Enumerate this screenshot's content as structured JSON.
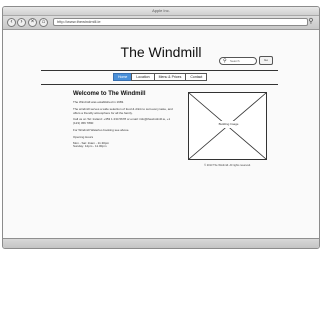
{
  "browser": {
    "title": "Apple Inc.",
    "url": "http://www.thewindmill.ie"
  },
  "header": {
    "logo": "The Windmill",
    "search_placeholder": "Search",
    "go_label": "Go"
  },
  "nav": {
    "items": [
      "Home",
      "Location",
      "Menu & Prices",
      "Contact"
    ],
    "active": "Home"
  },
  "main": {
    "heading": "Welcome to The Windmill",
    "paragraphs": [
      "The Windmill was established in 1983.",
      "The windmill serves a wide selection of food & drink to suit every taste, and offers a friendly atmosphere for all the family.",
      "Call us on Tel: Ireland: +353 1 234 5678 or email: info@thewindmill.ie, +1 (123) 456 7890",
      "For Windmill Waterloo booking see above.",
      "Opening Hours",
      "Mon - Sat: 11am - 11.30pm",
      "Sunday: 12pm - 11.00pm"
    ]
  },
  "image": {
    "label": "Building Image",
    "caption": "© 2013 The Windmill. All rights reserved."
  }
}
